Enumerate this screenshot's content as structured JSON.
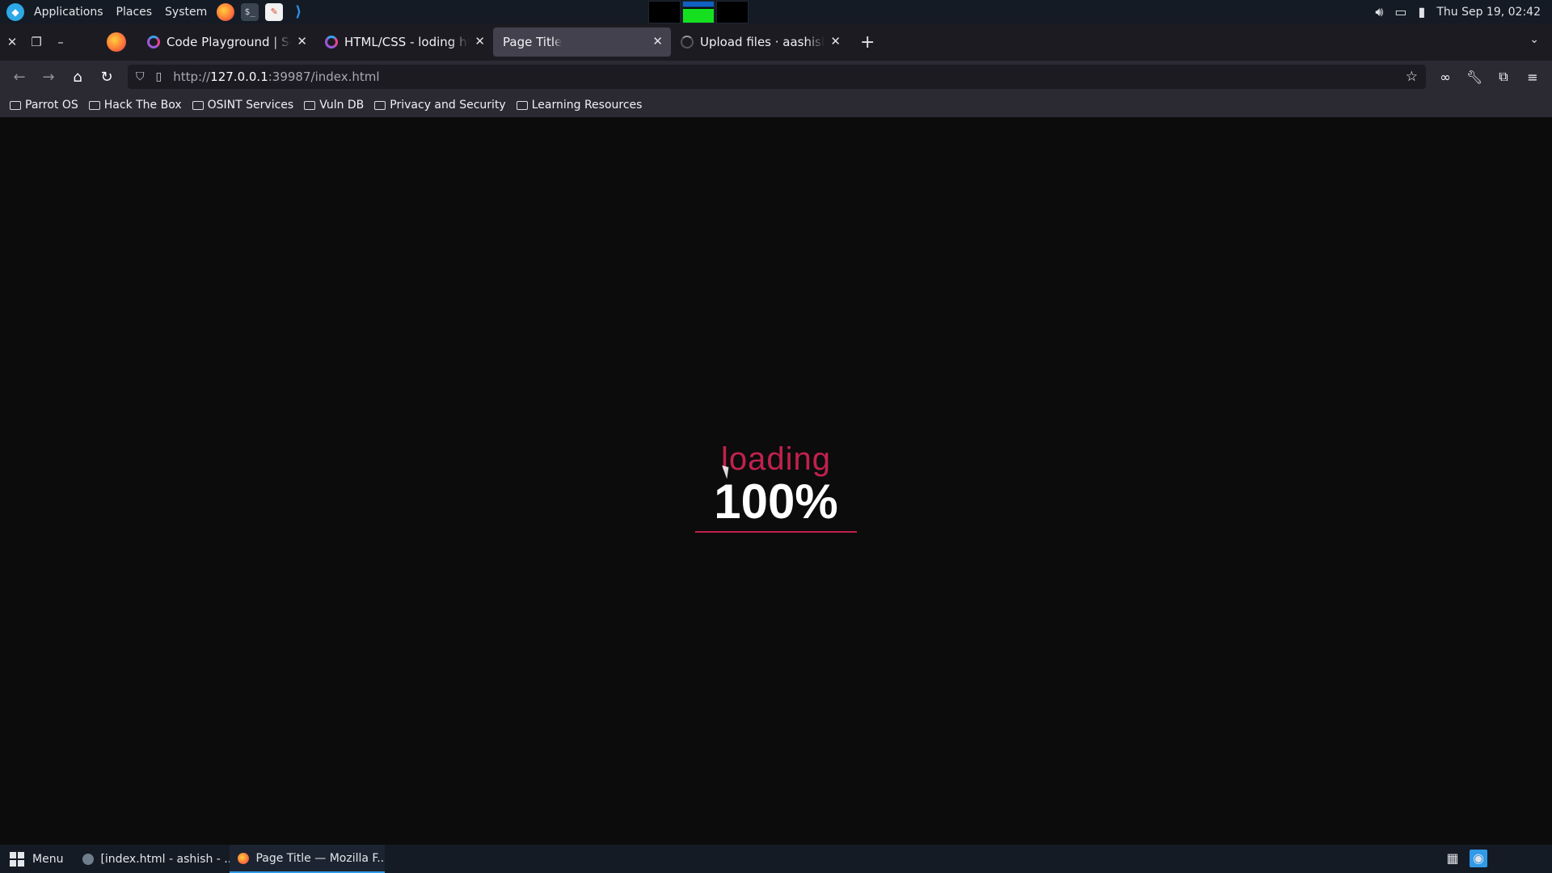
{
  "system_panel": {
    "menus": [
      "Applications",
      "Places",
      "System"
    ],
    "clock": "Thu Sep 19, 02:42"
  },
  "browser": {
    "tabs": [
      {
        "title": "Code Playground | Sololearn",
        "active": false
      },
      {
        "title": "HTML/CSS - loding html CSS",
        "active": false
      },
      {
        "title": "Page Title",
        "active": true
      },
      {
        "title": "Upload files · aashishraaz",
        "active": false
      }
    ],
    "url": {
      "scheme": "http://",
      "host": "127.0.0.1",
      "path": ":39987/index.html"
    },
    "bookmarks": [
      "Parrot OS",
      "Hack The Box",
      "OSINT Services",
      "Vuln DB",
      "Privacy and Security",
      "Learning Resources"
    ]
  },
  "page": {
    "loading_label": "loading",
    "percent_text": "100%",
    "progress_fraction": 1.0,
    "accent_color": "#c2214d"
  },
  "taskbar": {
    "menu_label": "Menu",
    "tasks": [
      {
        "title": "[index.html - ashish - ..."
      },
      {
        "title": "Page Title — Mozilla F..."
      }
    ]
  },
  "icons": {
    "sys": [
      "parrot-logo-icon",
      "firefox-launcher-icon",
      "terminal-launcher-icon",
      "text-editor-launcher-icon",
      "vscode-launcher-icon",
      "volume-icon",
      "display-icon",
      "battery-icon"
    ],
    "nav": [
      "back-icon",
      "forward-icon",
      "home-icon",
      "reload-icon",
      "shield-icon",
      "page-icon",
      "bookmark-star-icon",
      "mask-icon",
      "wrench-icon",
      "extensions-icon",
      "hamburger-menu-icon"
    ]
  }
}
